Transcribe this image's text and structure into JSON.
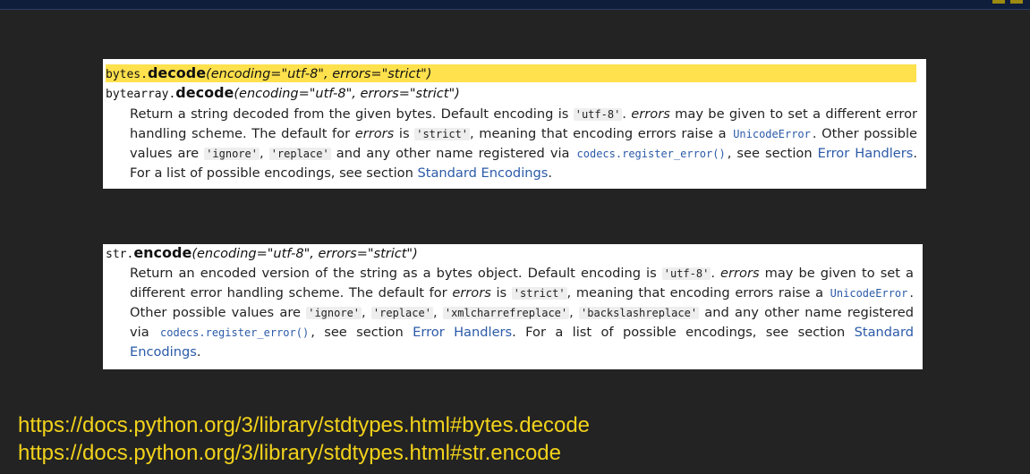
{
  "decode_box": {
    "sig1_prefix": "bytes",
    "sig1_name": "decode",
    "sig1_args": "(encoding=\"utf-8\", errors=\"strict\")",
    "sig2_prefix": "bytearray",
    "sig2_name": "decode",
    "sig2_args": "(encoding=\"utf-8\", errors=\"strict\")",
    "text_1": "Return a string decoded from the given bytes. Default encoding is ",
    "code_utf8": "'utf-8'",
    "text_2": ". ",
    "em_errors_1": "errors",
    "text_3": " may be given to set a different error handling scheme. The default for ",
    "em_errors_2": "errors",
    "text_4": " is ",
    "code_strict": "'strict'",
    "text_5": ", meaning that encoding errors raise a ",
    "link_unicodeerror": "UnicodeError",
    "text_6": ". Other possible values are ",
    "code_ignore": "'ignore'",
    "text_7": ", ",
    "code_replace": "'replace'",
    "text_8": " and any other name registered via ",
    "link_register": "codecs.register_error()",
    "text_9": ", see section ",
    "link_error_handlers": "Error Handlers",
    "text_10": ". For a list of possible encodings, see section ",
    "link_standard_encodings": "Standard Encodings",
    "text_11": "."
  },
  "encode_box": {
    "sig_prefix": "str",
    "sig_name": "encode",
    "sig_args": "(encoding=\"utf-8\", errors=\"strict\")",
    "text_1": "Return an encoded version of the string as a bytes object. Default encoding is ",
    "code_utf8": "'utf-8'",
    "text_2": ". ",
    "em_errors_1": "errors",
    "text_3": " may be given to set a different error handling scheme. The default for ",
    "em_errors_2": "errors",
    "text_4": " is ",
    "code_strict": "'strict'",
    "text_5": ", meaning that encoding errors raise a ",
    "link_unicodeerror": "UnicodeError",
    "text_6": ". Other possible values are ",
    "code_ignore": "'ignore'",
    "sep_1": ", ",
    "code_replace": "'replace'",
    "sep_2": ", ",
    "code_xml": "'xmlcharrefreplace'",
    "sep_3": ", ",
    "code_backslash": "'backslashreplace'",
    "text_7": " and any other name registered via ",
    "link_register": "codecs.register_error()",
    "text_8": ", see section ",
    "link_error_handlers": "Error Handlers",
    "text_9": ". For a list of possible encodings, see section ",
    "link_standard_encodings": "Standard Encodings",
    "text_10": "."
  },
  "urls": {
    "decode_url": "https://docs.python.org/3/library/stdtypes.html#bytes.decode",
    "encode_url": "https://docs.python.org/3/library/stdtypes.html#str.encode"
  },
  "colors": {
    "background": "#232323",
    "highlight": "#ffe14d",
    "link": "#2b5aa8",
    "url_text": "#f2d21b"
  }
}
